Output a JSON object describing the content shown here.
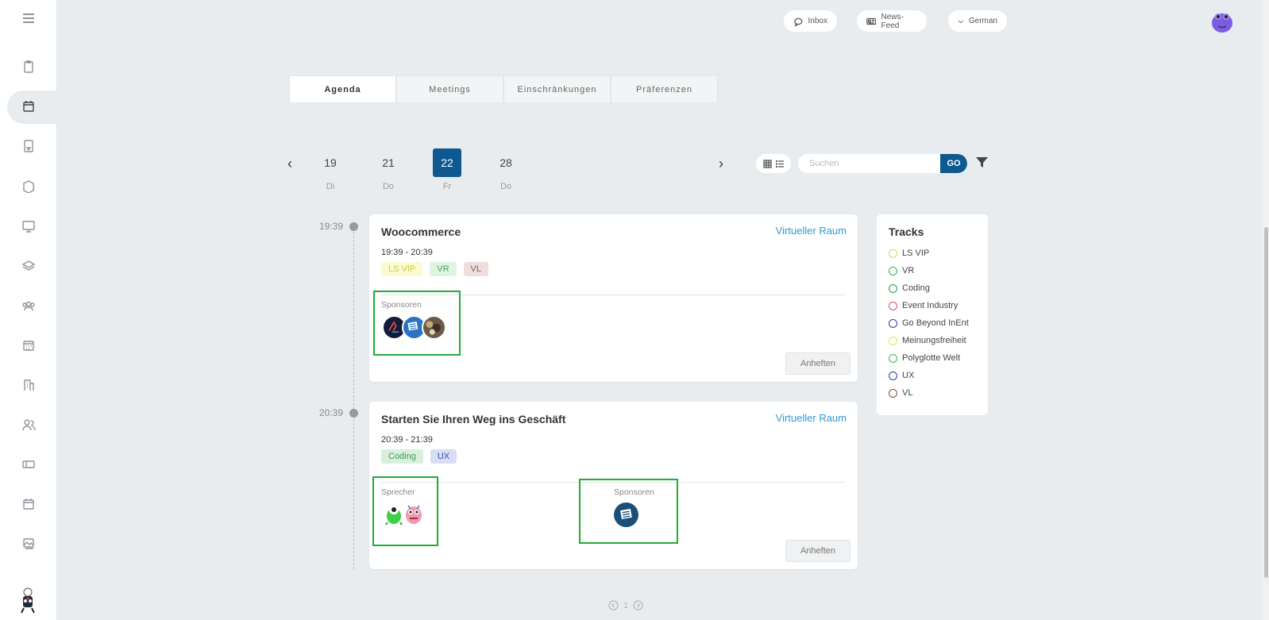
{
  "topbar": {
    "inbox_label": "Inbox",
    "newsfeed_label": "News-Feed",
    "language_label": "German"
  },
  "tabs": [
    {
      "label": "Agenda",
      "active": true
    },
    {
      "label": "Meetings",
      "active": false
    },
    {
      "label": "Einschränkungen",
      "active": false
    },
    {
      "label": "Präferenzen",
      "active": false
    }
  ],
  "date_nav": {
    "days": [
      {
        "num": "19",
        "weekday": "Di"
      },
      {
        "num": "21",
        "weekday": "Do"
      },
      {
        "num": "22",
        "weekday": "Fr"
      },
      {
        "num": "28",
        "weekday": "Do"
      }
    ],
    "active_index": 2
  },
  "search": {
    "placeholder": "Suchen",
    "go_label": "GO"
  },
  "sessions": [
    {
      "start": "19:39",
      "title": "Woocommerce",
      "room": "Virtueller Raum",
      "time_range": "19:39 - 20:39",
      "tags": [
        {
          "label": "LS VIP",
          "bg": "#fbfbd2",
          "fg": "#c9c94a"
        },
        {
          "label": "VR",
          "bg": "#dff4e1",
          "fg": "#4aa45a"
        },
        {
          "label": "VL",
          "bg": "#efdede",
          "fg": "#8a5a5a"
        }
      ],
      "sponsors_label": "Sponsoren",
      "pin_label": "Anheften"
    },
    {
      "start": "20:39",
      "title": "Starten Sie Ihren Weg ins Geschäft",
      "room": "Virtueller Raum",
      "time_range": "20:39 - 21:39",
      "tags": [
        {
          "label": "Coding",
          "bg": "#d9efdd",
          "fg": "#3f9a52"
        },
        {
          "label": "UX",
          "bg": "#d8dcf5",
          "fg": "#3b4fb0"
        }
      ],
      "speakers_label": "Sprecher",
      "sponsors_label": "Sponsoren",
      "pin_label": "Anheften"
    }
  ],
  "tracks": {
    "title": "Tracks",
    "items": [
      {
        "label": "LS VIP",
        "color": "#d8d84a"
      },
      {
        "label": "VR",
        "color": "#38b24a"
      },
      {
        "label": "Coding",
        "color": "#2f9a40"
      },
      {
        "label": "Event Industry",
        "color": "#e04a7a"
      },
      {
        "label": "Go Beyond InEnt",
        "color": "#2b3f9a"
      },
      {
        "label": "Meinungsfreiheit",
        "color": "#e3e34a"
      },
      {
        "label": "Polyglotte Welt",
        "color": "#3bb84a"
      },
      {
        "label": "UX",
        "color": "#2b3f9a"
      },
      {
        "label": "VL",
        "color": "#8a5030"
      }
    ]
  },
  "pagination": {
    "current": "1"
  }
}
